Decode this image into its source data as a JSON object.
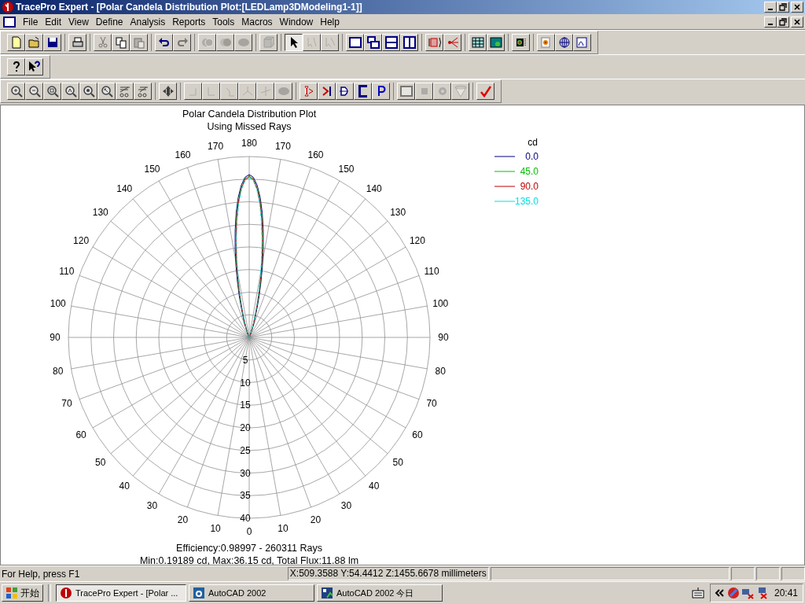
{
  "window": {
    "title": "TracePro Expert - [Polar Candela Distribution Plot:[LEDLamp3DModeling1-1]]"
  },
  "menu": [
    "File",
    "Edit",
    "View",
    "Define",
    "Analysis",
    "Reports",
    "Tools",
    "Macros",
    "Window",
    "Help"
  ],
  "toolbars": [
    [
      [
        {
          "kind": "new",
          "disabled": false
        },
        {
          "kind": "open",
          "disabled": false
        },
        {
          "kind": "save",
          "disabled": false
        }
      ],
      [
        {
          "kind": "print",
          "disabled": false
        }
      ],
      [
        {
          "kind": "cut",
          "disabled": true
        },
        {
          "kind": "copy",
          "disabled": false
        },
        {
          "kind": "paste",
          "disabled": true
        }
      ],
      [
        {
          "kind": "undo",
          "disabled": false
        },
        {
          "kind": "redo",
          "disabled": true
        }
      ],
      [
        {
          "kind": "union",
          "disabled": true
        },
        {
          "kind": "intersect",
          "disabled": true
        },
        {
          "kind": "blob",
          "disabled": true
        }
      ],
      [
        {
          "kind": "cube",
          "disabled": true
        }
      ],
      [
        {
          "kind": "pointer",
          "disabled": false,
          "pressed": true
        },
        {
          "kind": "pointer2",
          "disabled": true,
          "pressed": false
        },
        {
          "kind": "pointer3",
          "disabled": true,
          "pressed": false
        }
      ],
      [
        {
          "kind": "window",
          "disabled": false
        },
        {
          "kind": "cascade",
          "disabled": false
        },
        {
          "kind": "tileh",
          "disabled": false
        },
        {
          "kind": "tilev",
          "disabled": false
        }
      ],
      [
        {
          "kind": "source",
          "disabled": false
        },
        {
          "kind": "rays",
          "disabled": false
        }
      ],
      [
        {
          "kind": "grid",
          "disabled": false
        },
        {
          "kind": "gridmap",
          "disabled": false
        }
      ],
      [
        {
          "kind": "map",
          "disabled": false
        }
      ],
      [
        {
          "kind": "target",
          "disabled": false
        },
        {
          "kind": "globe",
          "disabled": false
        },
        {
          "kind": "graph",
          "disabled": false
        }
      ]
    ],
    [
      [
        {
          "kind": "help",
          "disabled": false
        },
        {
          "kind": "contexthelp",
          "disabled": false
        }
      ]
    ],
    [
      [
        {
          "kind": "zoomin",
          "disabled": false
        },
        {
          "kind": "zoomout",
          "disabled": false
        },
        {
          "kind": "zoomwin",
          "disabled": false
        },
        {
          "kind": "zoomall",
          "disabled": false
        },
        {
          "kind": "zoomsel",
          "disabled": false
        },
        {
          "kind": "zoomprev",
          "disabled": false
        },
        {
          "kind": "trace1",
          "disabled": false
        },
        {
          "kind": "trace2",
          "disabled": false
        }
      ],
      [
        {
          "kind": "pan",
          "disabled": false
        }
      ],
      [
        {
          "kind": "xy",
          "disabled": true
        },
        {
          "kind": "yz",
          "disabled": true
        },
        {
          "kind": "xz",
          "disabled": true
        },
        {
          "kind": "iso",
          "disabled": true
        },
        {
          "kind": "axes",
          "disabled": true
        },
        {
          "kind": "blob",
          "disabled": true
        }
      ],
      [
        {
          "kind": "lens",
          "disabled": false
        },
        {
          "kind": "mirror",
          "disabled": false
        },
        {
          "kind": "bulb",
          "disabled": false
        },
        {
          "kind": "bracket",
          "disabled": false
        },
        {
          "kind": "p",
          "disabled": false
        }
      ],
      [
        {
          "kind": "window",
          "disabled": true
        },
        {
          "kind": "square",
          "disabled": true
        },
        {
          "kind": "gear",
          "disabled": true
        },
        {
          "kind": "cone",
          "disabled": true
        }
      ],
      [
        {
          "kind": "check",
          "disabled": false
        }
      ]
    ]
  ],
  "plot": {
    "title": "Polar Candela Distribution Plot",
    "subtitle": "Using Missed Rays",
    "angle_labels": [
      "180",
      "170",
      "170",
      "160",
      "160",
      "150",
      "150",
      "140",
      "140",
      "130",
      "130",
      "120",
      "120",
      "110",
      "110",
      "100",
      "100",
      "90",
      "90",
      "80",
      "80",
      "70",
      "70",
      "60",
      "60",
      "50",
      "50",
      "40",
      "40",
      "30",
      "30",
      "20",
      "20",
      "10",
      "10",
      "0"
    ],
    "radial_labels": [
      "5",
      "10",
      "15",
      "20",
      "25",
      "30",
      "35",
      "40"
    ],
    "legend_title": "cd",
    "series": [
      {
        "name": "0.0",
        "color": "#000080"
      },
      {
        "name": "45.0",
        "color": "#00c000"
      },
      {
        "name": "90.0",
        "color": "#c00000"
      },
      {
        "name": "135.0",
        "color": "#00e0e0"
      }
    ],
    "footer": [
      "Efficiency:0.98997 - 260311 Rays",
      "Min:0.19189 cd, Max:36.15 cd, Total Flux:11.88 lm"
    ]
  },
  "status_bar": {
    "help": "For Help, press F1",
    "coordinates": "X:509.3588 Y:54.4412 Z:1455.6678 millimeters"
  },
  "taskbar": {
    "start": "开始",
    "tasks": [
      {
        "label": "TracePro Expert - [Polar ...",
        "selected": true
      },
      {
        "label": "AutoCAD 2002",
        "selected": false
      },
      {
        "label": "AutoCAD 2002 今日",
        "selected": false
      }
    ],
    "clock": "20:41"
  }
}
